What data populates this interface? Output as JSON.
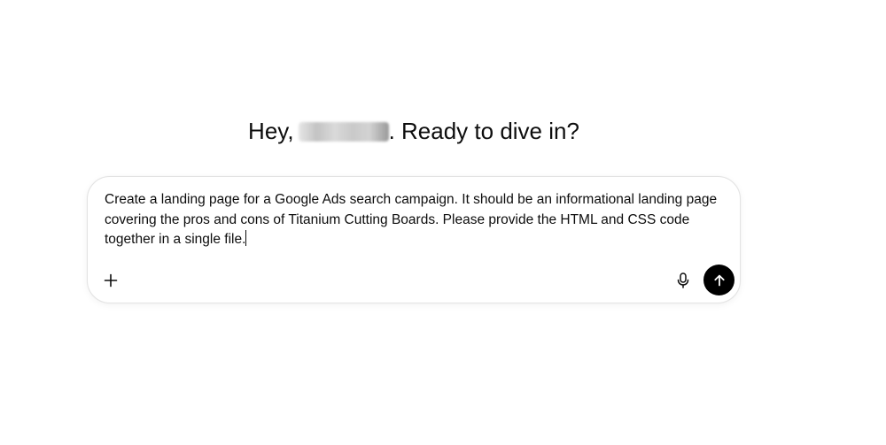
{
  "greeting": {
    "prefix": "Hey,",
    "suffix": ". Ready to dive in?"
  },
  "composer": {
    "prompt_text": "Create a landing page for a Google Ads search campaign. It should be an informational landing page covering the pros and cons of Titanium Cutting Boards. Please provide the HTML and CSS code together in a single file."
  },
  "icons": {
    "attach": "plus-icon",
    "voice": "microphone-icon",
    "send": "arrow-up-icon"
  },
  "colors": {
    "text": "#0d0d0d",
    "send_button_bg": "#000000",
    "composer_border": "#e3e3e3"
  }
}
